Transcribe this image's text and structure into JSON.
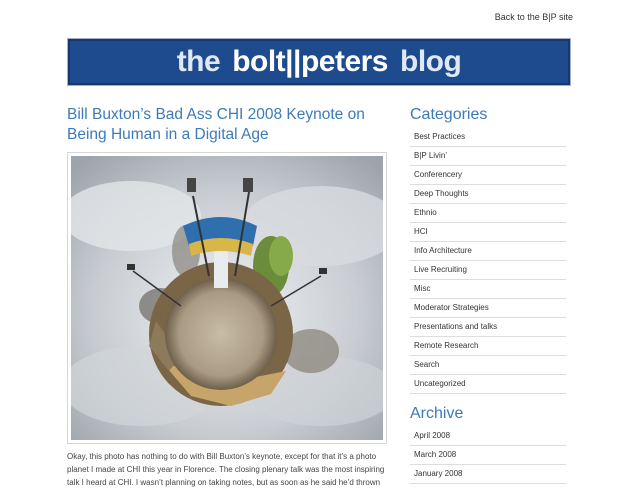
{
  "header": {
    "back_link": "Back to the B|P site",
    "banner_prefix": "the",
    "banner_brand": "bolt||peters",
    "banner_suffix": "blog"
  },
  "post": {
    "title": "Bill Buxton’s Bad Ass CHI 2008 Keynote on Being Human in a Digital Age",
    "sign_text": "Welcome to CHI 2008",
    "body": "Okay, this photo has nothing to do with Bill Buxton’s keynote, except for that it’s a photo planet I made at CHI this year in Florence. The closing plenary talk was the most inspiring talk I heard at CHI. I wasn’t planning on taking notes, but as soon as he said he’d thrown"
  },
  "sidebar": {
    "categories_title": "Categories",
    "categories": [
      "Best Practices",
      "B|P Livin’",
      "Conferencery",
      "Deep Thoughts",
      "Ethnio",
      "HCI",
      "Info Architecture",
      "Live Recruiting",
      "Misc",
      "Moderator Strategies",
      "Presentations and talks",
      "Remote Research",
      "Search",
      "Uncategorized"
    ],
    "archive_title": "Archive",
    "archive": [
      "April 2008",
      "March 2008",
      "January 2008"
    ]
  },
  "colors": {
    "banner_bg": "#1e4a8e",
    "title_blue": "#3c7bb8"
  }
}
